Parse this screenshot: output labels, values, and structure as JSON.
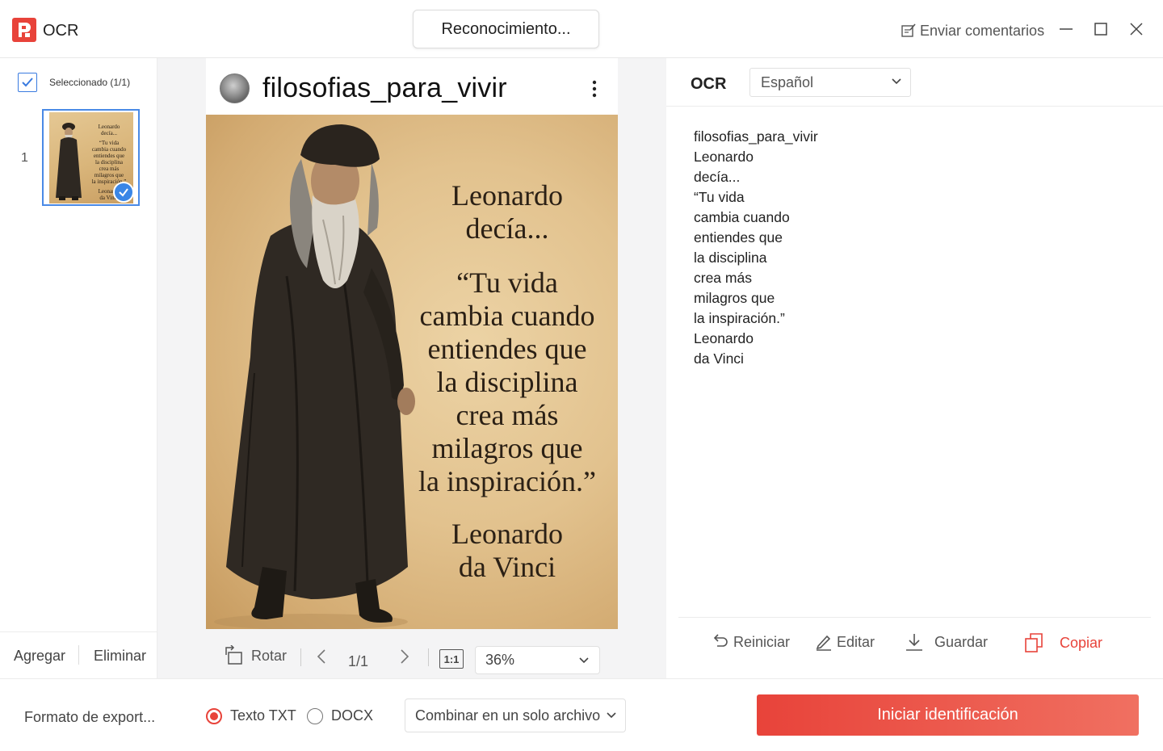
{
  "titlebar": {
    "app_name": "OCR",
    "recognize_button": "Reconocimiento...",
    "feedback": "Enviar comentarios"
  },
  "sidebar": {
    "selected_label": "Seleccionado (1/1)",
    "page_number": "1",
    "thumbnail_text": [
      "Leonardo",
      "decía...",
      "“Tu vida",
      "cambia cuando",
      "entiendes que",
      "la disciplina",
      "crea más",
      "milagros que",
      "la inspiración.”",
      "Leonardo",
      "da Vinci"
    ],
    "add_label": "Agregar",
    "delete_label": "Eliminar"
  },
  "preview": {
    "username": "filosofias_para_vivir",
    "quote_lines": [
      "Leonardo",
      "decía...",
      "“Tu vida",
      "cambia cuando",
      "entiendes que",
      "la disciplina",
      "crea más",
      "milagros que",
      "la inspiración.”",
      "Leonardo",
      "da Vinci"
    ],
    "toolbar": {
      "rotate_label": "Rotar",
      "page_indicator": "1/1",
      "fit_label": "1:1",
      "zoom": "36%"
    }
  },
  "ocr_panel": {
    "label": "OCR",
    "language": "Español",
    "result_lines": [
      "filosofias_para_vivir",
      "Leonardo",
      "decía...",
      "“Tu vida",
      "cambia cuando",
      "entiendes que",
      "la disciplina",
      "crea más",
      "milagros que",
      "la inspiración.”",
      "Leonardo",
      "da Vinci"
    ],
    "actions": {
      "reset": "Reiniciar",
      "edit": "Editar",
      "save": "Guardar",
      "copy": "Copiar"
    }
  },
  "bottombar": {
    "format_label": "Formato de export...",
    "format_options": [
      "Texto TXT",
      "DOCX"
    ],
    "selected_format": "Texto TXT",
    "merge_option": "Combinar en un solo archivo",
    "start_button": "Iniciar identificación"
  },
  "colors": {
    "accent": "#e8433a",
    "selection_blue": "#3a86e6",
    "panel_bg": "#f4f4f5"
  }
}
